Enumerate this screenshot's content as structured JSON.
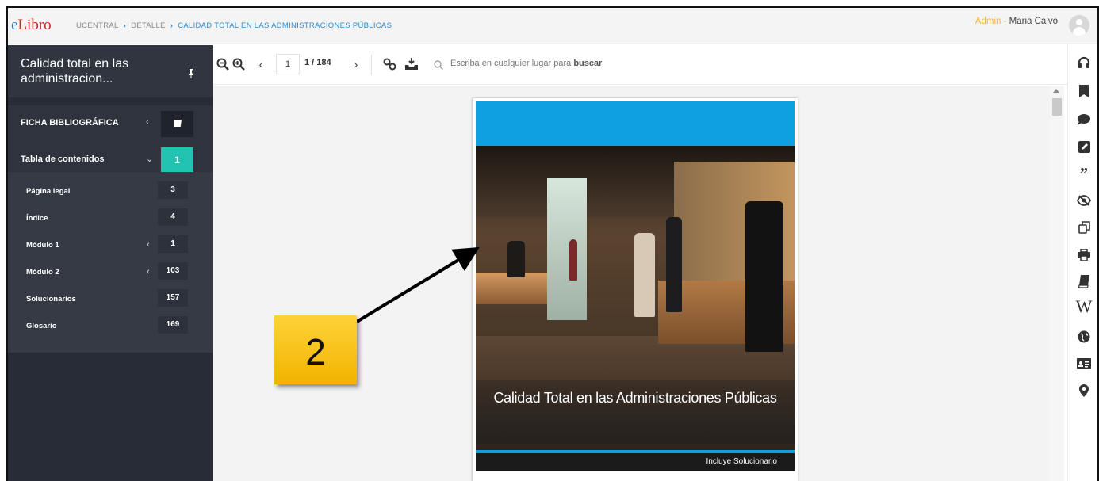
{
  "header": {
    "logo_e": "e",
    "logo_rest": "Libro",
    "breadcrumb": [
      "UCENTRAL",
      "DETALLE",
      "CALIDAD TOTAL EN LAS ADMINISTRACIONES PÚBLICAS"
    ],
    "user_role": "Admin",
    "user_sep": " - ",
    "user_name": "Maria Calvo"
  },
  "sidebar": {
    "title": "Calidad total en las administracion...",
    "ficha_label": "FICHA BIBLIOGRÁFICA",
    "toc_label": "Tabla de contenidos",
    "toc_page": "1",
    "toc_items": [
      {
        "label": "Página legal",
        "page": "3"
      },
      {
        "label": "Índice",
        "page": "4"
      },
      {
        "label": "Módulo 1",
        "page": "1"
      },
      {
        "label": "Módulo 2",
        "page": "103"
      },
      {
        "label": "Solucionarios",
        "page": "157"
      },
      {
        "label": "Glosario",
        "page": "169"
      }
    ]
  },
  "toolbar": {
    "current_page": "1",
    "page_total": "1 / 184",
    "search_placeholder_pre": "Escriba en cualquier lugar para ",
    "search_placeholder_bold": "buscar"
  },
  "cover": {
    "title": "Calidad Total en las Administraciones Públicas",
    "footer": "Incluye Solucionario"
  },
  "annotation": {
    "number": "2"
  },
  "icons": [
    "zoom-out-icon",
    "zoom-in-icon",
    "prev-page-icon",
    "next-page-icon",
    "link-icon",
    "download-icon",
    "search-icon",
    "toc-toggle-icon",
    "headphones-icon",
    "bookmark-icon",
    "comment-icon",
    "edit-icon",
    "quote-icon",
    "hide-icon",
    "copy-icon",
    "print-icon",
    "book-icon",
    "wikipedia-icon",
    "globe-icon",
    "id-card-icon",
    "location-icon"
  ],
  "colors": {
    "accent_teal": "#22c3b0",
    "accent_blue": "#2b8ad0",
    "sidebar_bg": "#272c36",
    "callout": "#f5c000"
  }
}
